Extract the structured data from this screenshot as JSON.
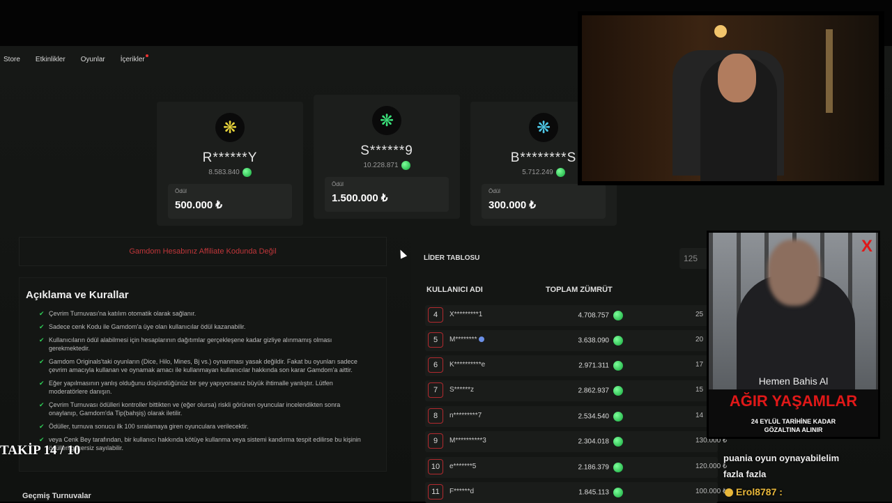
{
  "nav": {
    "items": [
      "Store",
      "Etkinlikler",
      "Oyunlar",
      "İçerikler"
    ]
  },
  "podium": [
    {
      "name": "S******9",
      "score": "10.228.871",
      "prize_label": "Ödül",
      "prize": "1.500.000 ₺",
      "badge_color": "#3be07a"
    },
    {
      "name": "R******Y",
      "score": "8.583.840",
      "prize_label": "Ödül",
      "prize": "500.000 ₺",
      "badge_color": "#e6d23a"
    },
    {
      "name": "B********S",
      "score": "5.712.249",
      "prize_label": "Ödül",
      "prize": "300.000 ₺",
      "badge_color": "#4ec9e8"
    }
  ],
  "affiliate_warning": "Gamdom Hesabınız Affiliate Kodunda Değil",
  "rules": {
    "title": "Açıklama ve Kurallar",
    "items": [
      "Çevrim Turnuvası'na katılım otomatik olarak sağlanır.",
      "Sadece cenk Kodu ile Gamdom'a üye olan kullanıcılar ödül kazanabilir.",
      "Kullanıcıların ödül alabilmesi için hesaplarının dağıtımlar gerçekleşene kadar gizliye alınmamış olması gerekmektedir.",
      "Gamdom Originals'taki oyunların (Dice, Hilo, Mines, Bj vs.) oynanması yasak değildir. Fakat bu oyunları sadece çevrim amacıyla kullanan ve oynamak amacı ile kullanmayan kullanıcılar hakkında son karar Gamdom'a aittir.",
      "Eğer yapılmasının yanlış olduğunu düşündüğünüz bir şey yapıyorsanız büyük ihtimalle yanlıştır. Lütfen moderatörlere danışın.",
      "Çevrim Turnuvası ödülleri kontroller bittikten ve (eğer olursa) riskli görünen oyuncular incelendikten sonra onaylanıp, Gamdom'da Tip(bahşiş) olarak iletilir.",
      "Ödüller, turnuva sonucu ilk 100 sıralamaya giren oyunculara verilecektir.",
      "veya Cenk Bey tarafından, bir kullanıcı hakkında kötüye kullanma veya sistemi kandırma tespit edilirse bu kişinin ödülleri geçersiz sayılabilir."
    ]
  },
  "past_tournaments": "Geçmiş Turnuvalar",
  "leaderboard": {
    "title": "LİDER TABLOSU",
    "count": "125",
    "col_user": "KULLANICI ADI",
    "col_total": "TOPLAM ZÜMRÜT",
    "rows": [
      {
        "rank": "4",
        "user": "X*********1",
        "score": "4.708.757",
        "prize": "25"
      },
      {
        "rank": "5",
        "user": "M********",
        "score": "3.638.090",
        "prize": "20"
      },
      {
        "rank": "6",
        "user": "K**********e",
        "score": "2.971.311",
        "prize": "17"
      },
      {
        "rank": "7",
        "user": "S******z",
        "score": "2.862.937",
        "prize": "15"
      },
      {
        "rank": "8",
        "user": "n*********7",
        "score": "2.534.540",
        "prize": "14"
      },
      {
        "rank": "9",
        "user": "M**********3",
        "score": "2.304.018",
        "prize": "130.000 ₺"
      },
      {
        "rank": "10",
        "user": "e*******5",
        "score": "2.186.379",
        "prize": "120.000 ₺"
      },
      {
        "rank": "11",
        "user": "F******d",
        "score": "1.845.113",
        "prize": "100.000 ₺"
      }
    ]
  },
  "ad": {
    "cta": "Hemen Bahis Al",
    "headline": "AĞIR YAŞAMLAR",
    "line1": "24 EYLÜL TARİHİNE KADAR",
    "line2": "GÖZALTINA ALINIR",
    "close": "X"
  },
  "overlay": {
    "takip": "TAKİP 14 / 10",
    "chat_line1": "puania oyun oynayabilelim",
    "chat_line2": "fazla fazla",
    "chat_user": "Erol8787 :"
  },
  "colors": {
    "accent_red": "#c0363a",
    "gem_green": "#12a63a"
  }
}
